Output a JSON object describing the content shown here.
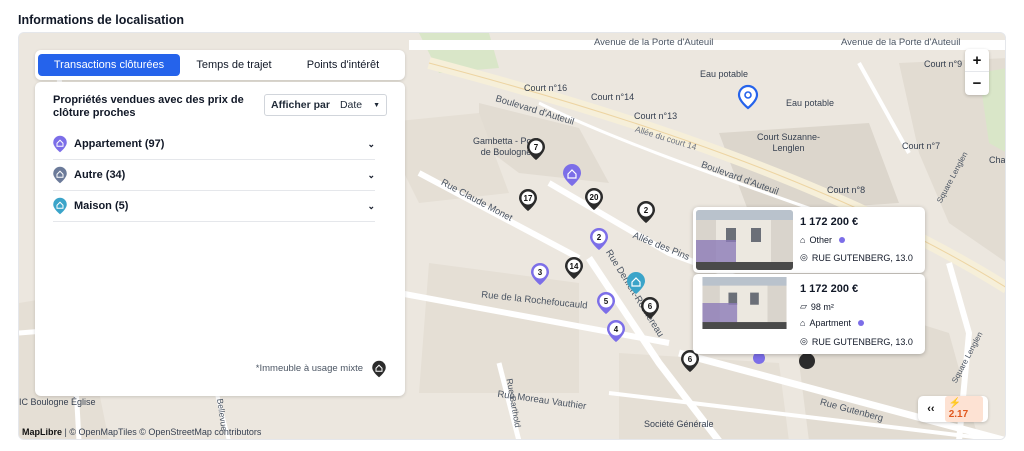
{
  "section": {
    "title": "Informations de localisation"
  },
  "tabs": [
    {
      "label": "Transactions clôturées",
      "active": true
    },
    {
      "label": "Temps de trajet",
      "active": false
    },
    {
      "label": "Points d'intérêt",
      "active": false
    }
  ],
  "panel": {
    "title": "Propriétés vendues avec des prix de clôture proches",
    "sort_label": "Afficher par",
    "sort_value": "Date",
    "categories": [
      {
        "label": "Appartement (97)",
        "color": "#7c6ee8",
        "icon": "apartment-pin-icon"
      },
      {
        "label": "Autre (34)",
        "color": "#6b7a99",
        "icon": "other-pin-icon"
      },
      {
        "label": "Maison (5)",
        "color": "#3ba4c9",
        "icon": "house-pin-icon"
      }
    ],
    "footnote": "*Immeuble à usage mixte"
  },
  "zoom": {
    "in": "+",
    "out": "−"
  },
  "map_labels": {
    "streets": [
      "Avenue de la Porte d'Auteuil",
      "Avenue de la Porte d'Auteuil",
      "Boulevard d'Auteuil",
      "Boulevard d'Auteuil",
      "Allée du court 14",
      "Rue Claude Monet",
      "Allée des Pins",
      "Rue de la Rochefoucauld",
      "Rue Denfert-Rochereau",
      "Rue Moreau Vauthier",
      "Rue Gutenberg",
      "Rue Barthold",
      "Square Lenglen",
      "Square Lenglen",
      "Rue de Bellevue"
    ],
    "pois": [
      "Court n°16",
      "Court n°14",
      "Court n°13",
      "Eau potable",
      "Eau potable",
      "Court Suzanne-\nLenglen",
      "Court n°7",
      "Court n°8",
      "Court n°9",
      "Gambetta - Pont\nde Boulogne",
      "IC Boulogne Église",
      "Société Générale",
      "Cha"
    ]
  },
  "markers": {
    "dark": [
      "7",
      "17",
      "20",
      "2",
      "14",
      "6",
      "6"
    ],
    "purple": [
      "2",
      "3",
      "5",
      "4"
    ]
  },
  "listings": [
    {
      "price": "1 172 200 €",
      "type": "Other",
      "address": "RUE GUTENBERG, 13.0"
    },
    {
      "price": "1 172 200 €",
      "area": "98 m²",
      "type": "Apartment",
      "address": "RUE GUTENBERG, 13.0"
    }
  ],
  "attribution": {
    "brand": "MapLibre",
    "text": "| © OpenMapTiles © OpenStreetMap contributors"
  },
  "widget": {
    "back": "‹‹",
    "score": "2.17"
  },
  "colors": {
    "accent": "#2563eb",
    "apartment": "#7c6ee8",
    "other": "#6b7a99",
    "house": "#3ba4c9",
    "marker_dark": "#2b2b2b",
    "score": "#e0581f"
  }
}
